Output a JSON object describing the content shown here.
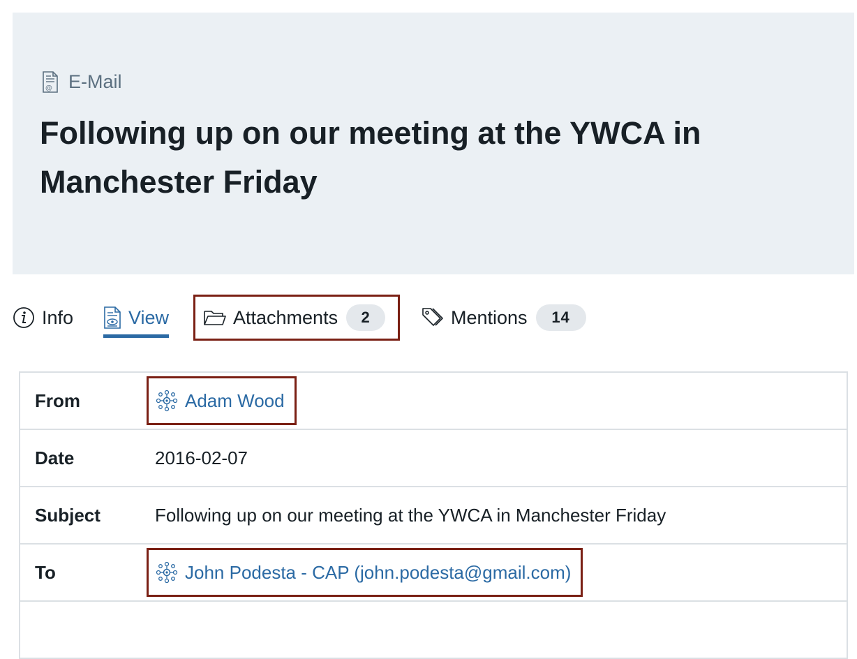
{
  "header": {
    "type_label": "E-Mail",
    "type_icon": "email-document-icon",
    "title": "Following up on our meeting at the YWCA in Manchester Friday"
  },
  "tabs": [
    {
      "label": "Info",
      "icon": "info-icon",
      "active": false
    },
    {
      "label": "View",
      "icon": "document-view-icon",
      "active": true
    },
    {
      "label": "Attachments",
      "icon": "folder-icon",
      "count": "2",
      "active": false
    },
    {
      "label": "Mentions",
      "icon": "tags-icon",
      "count": "14",
      "active": false
    }
  ],
  "fields": {
    "from": {
      "label": "From",
      "value": "Adam Wood",
      "icon": "entity-network-icon"
    },
    "date": {
      "label": "Date",
      "value": "2016-02-07"
    },
    "subject": {
      "label": "Subject",
      "value": "Following up on our meeting at the YWCA in Manchester Friday"
    },
    "to": {
      "label": "To",
      "value": "John Podesta - CAP (john.podesta@gmail.com)",
      "icon": "entity-network-icon"
    }
  },
  "colors": {
    "header_bg": "#ebf0f4",
    "link": "#2b6aa4",
    "highlight_border": "#7a2014",
    "badge_bg": "#e4e8ec"
  }
}
